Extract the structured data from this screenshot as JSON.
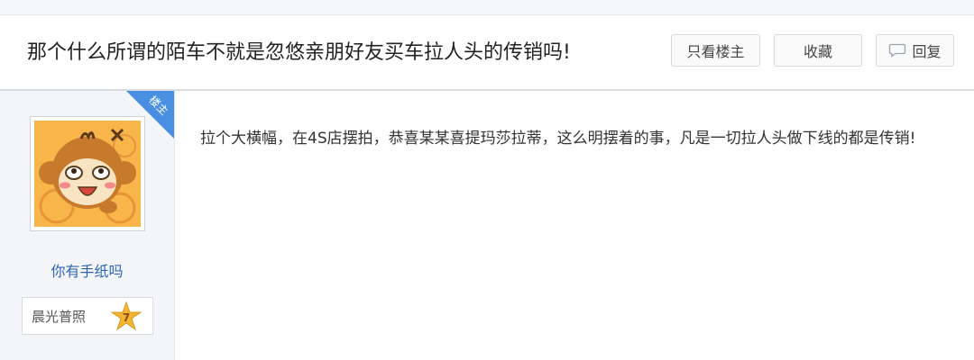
{
  "thread": {
    "title": "那个什么所谓的陌车不就是忽悠亲朋好友买车拉人头的传销吗!",
    "buttons": {
      "only_op": "只看楼主",
      "favorite": "收藏",
      "reply": "回复"
    }
  },
  "post": {
    "badge": "楼主",
    "author": {
      "name": "你有手纸吗",
      "rank_title": "晨光普照",
      "level": "7"
    },
    "content": "拉个大横幅，在4S店摆拍，恭喜某某喜提玛莎拉蒂，这么明摆着的事，凡是一切拉人头做下线的都是传销!"
  },
  "icons": {
    "reply": "speech-bubble-icon",
    "level": "star-badge-icon",
    "avatar": "monkey-avatar"
  },
  "colors": {
    "badge_blue": "#4a90e2",
    "username_blue": "#2d64b3",
    "star_gold": "#f2b632"
  }
}
